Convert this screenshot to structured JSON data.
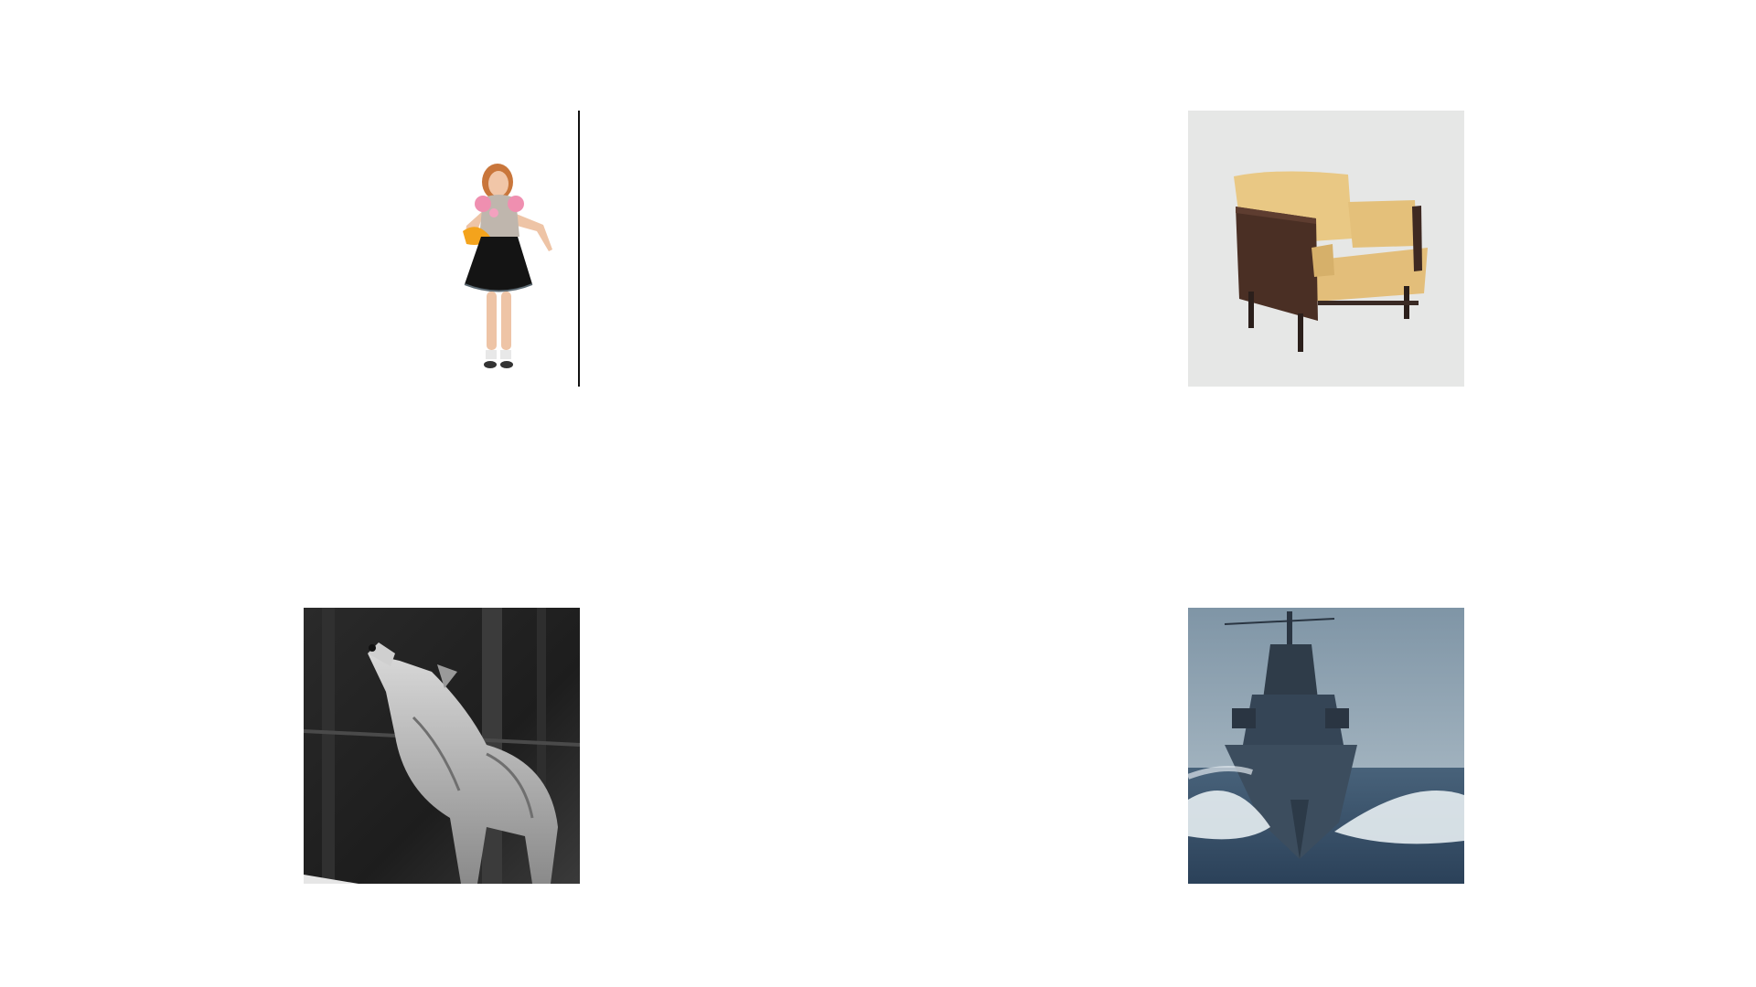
{
  "slide": {
    "background": "#ffffff",
    "images": [
      {
        "id": "dancer",
        "subject": "woman-dancing-in-black-skirt",
        "has_divider_line": true
      },
      {
        "id": "chair",
        "subject": "yellow-armchair",
        "backdrop": "#e6e7e6"
      },
      {
        "id": "wolf",
        "subject": "howling-wolf-in-snowy-forest"
      },
      {
        "id": "ship",
        "subject": "warship-cutting-through-waves"
      }
    ]
  }
}
